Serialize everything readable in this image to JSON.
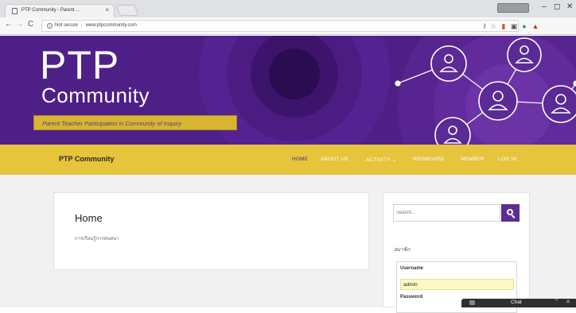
{
  "browser": {
    "tab_title": "PTP Community - Parent ...",
    "tab_close": "×",
    "new_tab": "",
    "win_minimize": "–",
    "win_maximize": "◻",
    "win_close": "✕",
    "back": "←",
    "forward": "→",
    "reload": "C",
    "security": "Not secure",
    "url": "www.ptpcommunity.com",
    "icons": [
      "key-icon",
      "star-icon",
      "extension-icon",
      "extension-icon",
      "extension-icon",
      "gmail-icon"
    ]
  },
  "hero": {
    "title": "PTP",
    "subtitle": "Community",
    "tagline": "Parent Teacher Participation in Community of Inquiry",
    "colors": {
      "background": "#4e1f86",
      "circles": "#6a2fa3",
      "tagline_bg": "#d7b531"
    }
  },
  "nav": {
    "site_title": "PTP Community",
    "items": [
      {
        "label": "HOME",
        "active": true
      },
      {
        "label": "ABOUT US"
      },
      {
        "label": "ACTIVITY ⌄"
      },
      {
        "label": "WEBBOARD"
      },
      {
        "label": "MEMBER"
      },
      {
        "label": "LOG IN"
      }
    ],
    "colors": {
      "bar": "#e6c43c",
      "active": "#4a2b74"
    }
  },
  "main": {
    "page_title": "Home",
    "body_text": "การเรียนรู้การสนทนา"
  },
  "sidebar": {
    "search_placeholder": "Search...",
    "member_heading": "สมาชิก",
    "username_label": "Username",
    "username_value": "admin",
    "password_label": "Password",
    "accent": "#5c2d91"
  },
  "chat": {
    "label": "Chat",
    "collapse": "^",
    "close": "✕"
  }
}
